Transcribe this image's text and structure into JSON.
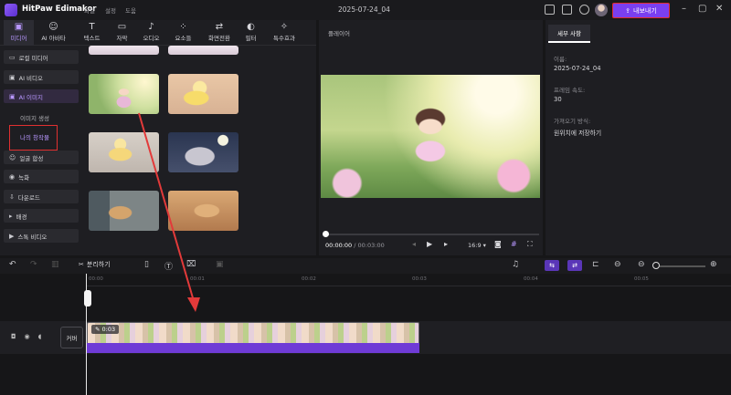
{
  "app": {
    "title": "HitPaw Edimakor",
    "menus": [
      "파일",
      "설정",
      "도움"
    ],
    "project_name": "2025-07-24_04",
    "export_label": "내보내기"
  },
  "categories": [
    {
      "label": "미디어",
      "icon": "media-icon",
      "glyph": "▣"
    },
    {
      "label": "AI 아바타",
      "icon": "avatar-icon",
      "glyph": "☺"
    },
    {
      "label": "텍스트",
      "icon": "text-icon",
      "glyph": "T"
    },
    {
      "label": "자막",
      "icon": "subtitle-icon",
      "glyph": "▭"
    },
    {
      "label": "오디오",
      "icon": "audio-icon",
      "glyph": "♪"
    },
    {
      "label": "요소들",
      "icon": "elements-icon",
      "glyph": "⁘"
    },
    {
      "label": "화면전환",
      "icon": "transition-icon",
      "glyph": "⇄"
    },
    {
      "label": "필터",
      "icon": "filter-icon",
      "glyph": "◐"
    },
    {
      "label": "특수효과",
      "icon": "effects-icon",
      "glyph": "✧"
    }
  ],
  "sidebar": {
    "items": [
      {
        "label": "로컬 미디어",
        "glyph": "▭"
      },
      {
        "label": "AI 비디오",
        "glyph": "▣"
      },
      {
        "label": "AI 이미지",
        "glyph": "▣"
      },
      {
        "label": "얼굴 합성",
        "glyph": "☺"
      },
      {
        "label": "녹화",
        "glyph": "◉"
      },
      {
        "label": "다운로드",
        "glyph": "⇩"
      },
      {
        "label": "배경",
        "glyph": "▸"
      },
      {
        "label": "스톡 비디오",
        "glyph": "▶"
      }
    ],
    "sub_items": [
      "이미지 생성",
      "나의 창작물"
    ]
  },
  "player": {
    "title": "플레이어",
    "current_time": "00:00:00",
    "total_time": "/ 00:03:00",
    "ratio": "16:9 ▾"
  },
  "details": {
    "tab": "세부 사항",
    "fields": [
      {
        "label": "이름:",
        "value": "2025-07-24_04"
      },
      {
        "label": "프레임 속도:",
        "value": "30"
      },
      {
        "label": "가져오기 방식:",
        "value": "원위치에 저장하기"
      }
    ]
  },
  "toolbar": {
    "split_label": "분리하기"
  },
  "timeline": {
    "ticks": [
      "00:00",
      "00:01",
      "00:02",
      "00:03",
      "00:04",
      "00:05"
    ],
    "cover_label": "커버",
    "clip_duration": "0:03"
  }
}
